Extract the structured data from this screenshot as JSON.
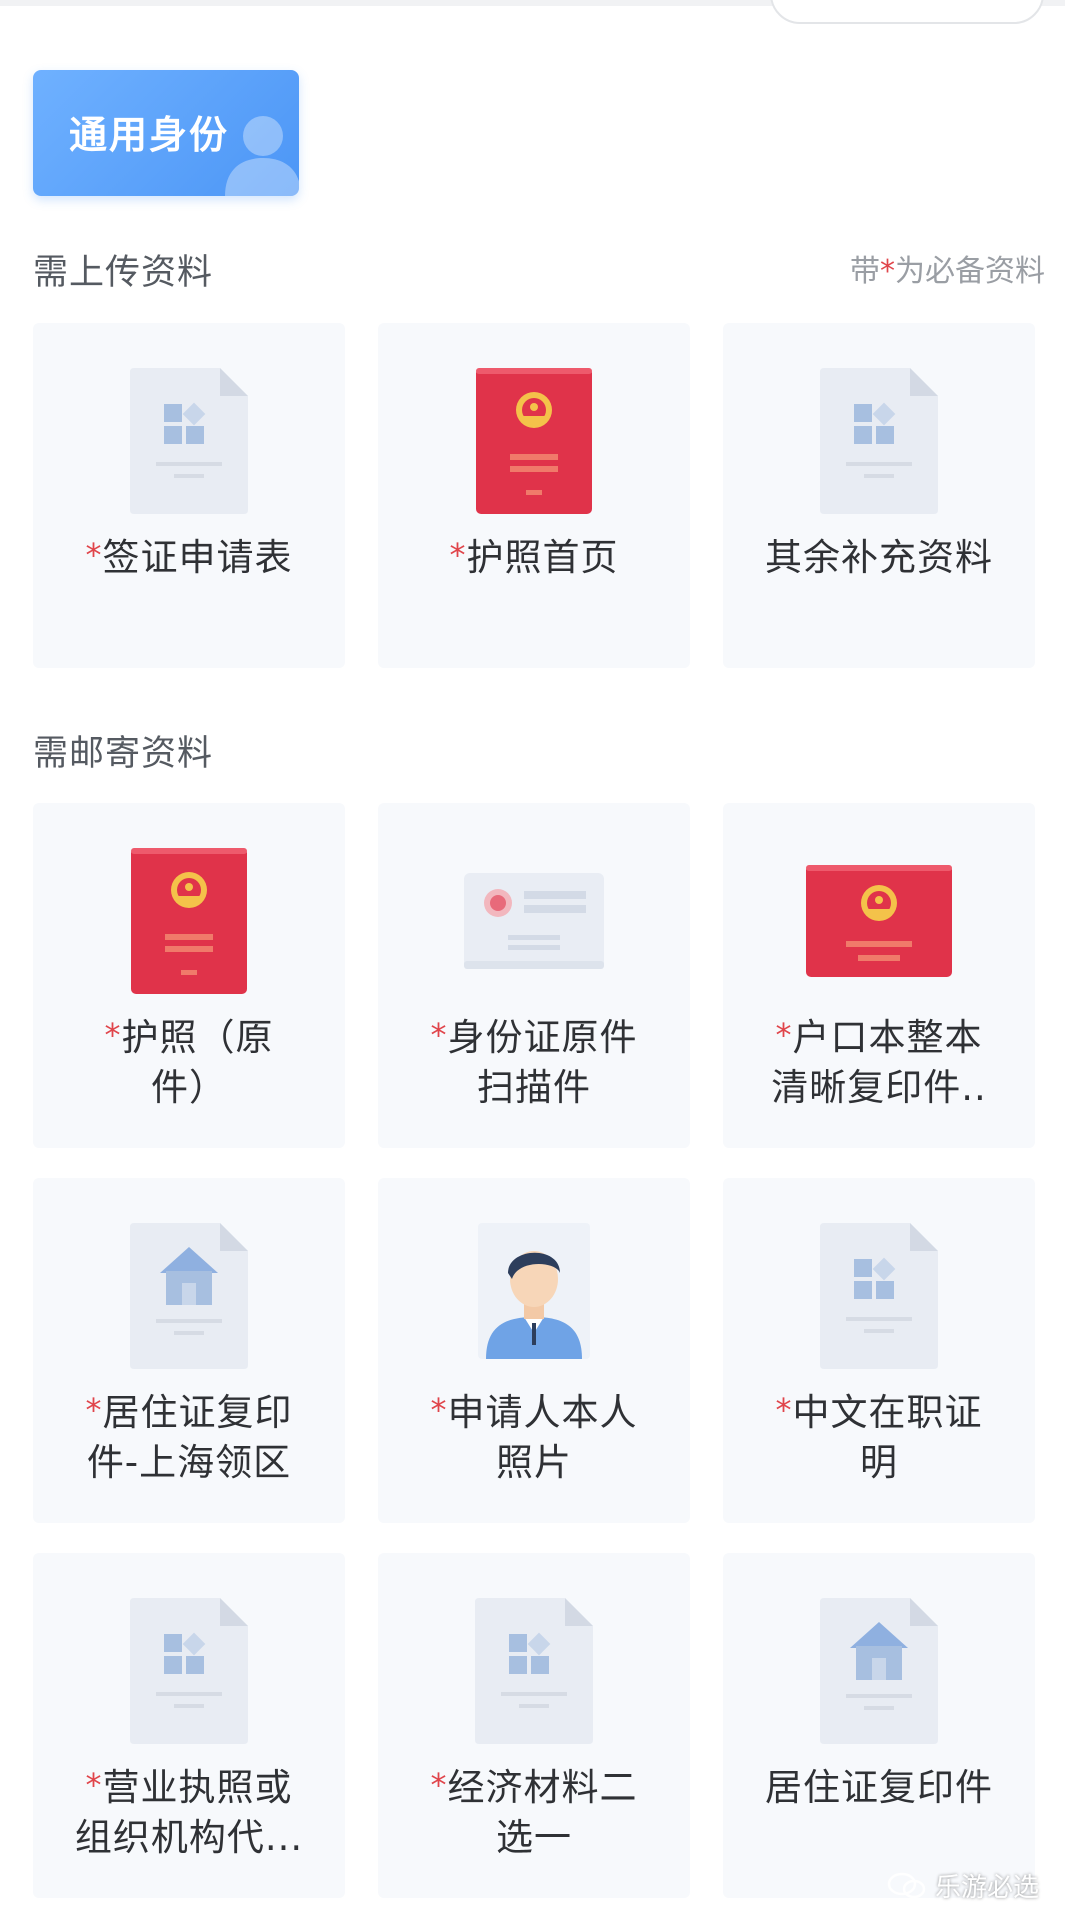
{
  "identity_tab": {
    "label": "通用身份"
  },
  "upload_section": {
    "title": "需上传资料",
    "note_prefix": "带",
    "note_star": "*",
    "note_suffix": "为必备资料",
    "cards": [
      {
        "required": true,
        "star": "*",
        "line1": "签证申请表",
        "line2": "",
        "icon": "document-icon"
      },
      {
        "required": true,
        "star": "*",
        "line1": "护照首页",
        "line2": "",
        "icon": "passport-icon"
      },
      {
        "required": false,
        "star": "",
        "line1": "其余补充资料",
        "line2": "",
        "icon": "document-icon"
      }
    ]
  },
  "mail_section": {
    "title": "需邮寄资料",
    "cards": [
      {
        "star": "*",
        "line1": "护照（原",
        "line2": "件）",
        "icon": "passport-icon"
      },
      {
        "star": "*",
        "line1": "身份证原件",
        "line2": "扫描件",
        "icon": "id-card-icon"
      },
      {
        "star": "*",
        "line1": "户口本整本",
        "line2": "清晰复印件..",
        "icon": "household-book-icon"
      },
      {
        "star": "*",
        "line1": "居住证复印",
        "line2": "件-上海领区",
        "icon": "house-document-icon"
      },
      {
        "star": "*",
        "line1": "申请人本人",
        "line2": "照片",
        "icon": "person-photo-icon"
      },
      {
        "star": "*",
        "line1": "中文在职证",
        "line2": "明",
        "icon": "document-icon"
      },
      {
        "star": "*",
        "line1": "营业执照或",
        "line2": "组织机构代...",
        "icon": "document-icon"
      },
      {
        "star": "*",
        "line1": "经济材料二",
        "line2": "选一",
        "icon": "document-icon"
      },
      {
        "star": "",
        "line1": "居住证复印件",
        "line2": "",
        "icon": "house-document-icon"
      }
    ]
  },
  "watermark": {
    "text": "乐游必选"
  },
  "colors": {
    "accent_blue": "#4c96f6",
    "required_red": "#e0454b",
    "passport_red": "#e0334a",
    "card_bg": "#f7f9fc"
  }
}
